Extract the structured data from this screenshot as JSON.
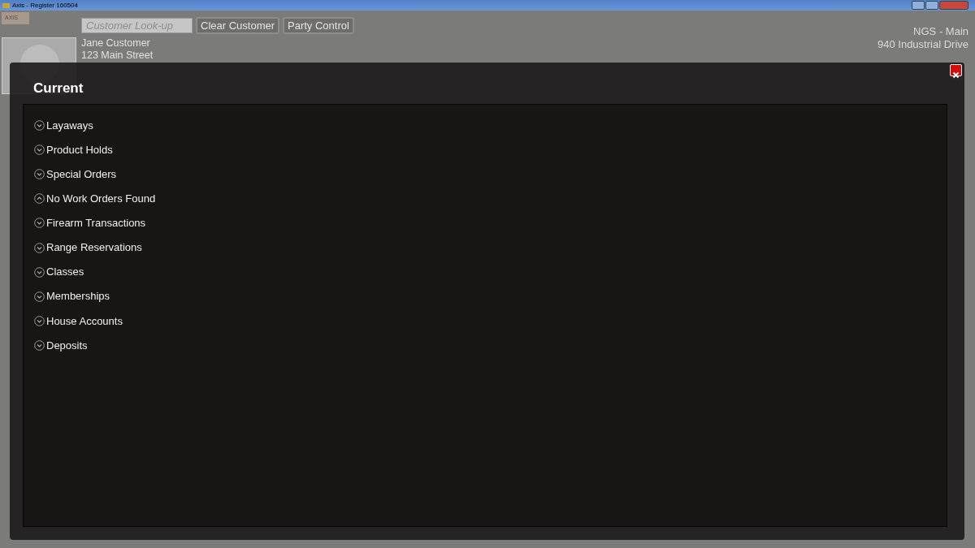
{
  "window": {
    "title": "Axis - Register  160504",
    "logo": "AXIS"
  },
  "customer_lookup": {
    "placeholder": "Customer Look-up"
  },
  "buttons": [
    "Clear Customer",
    "Party Control"
  ],
  "customer": {
    "lines": [
      "Jane Customer",
      "123 Main Street"
    ]
  },
  "store": {
    "name": "NGS - Main",
    "address": "940 Industrial Drive"
  },
  "dialog": {
    "title": "Current",
    "sections": [
      {
        "label": "Layaways",
        "expanded": false
      },
      {
        "label": "Product Holds",
        "expanded": false
      },
      {
        "label": "Special Orders",
        "expanded": false
      },
      {
        "label": "No Work Orders Found",
        "expanded": true
      },
      {
        "label": "Firearm Transactions",
        "expanded": false
      },
      {
        "label": "Range Reservations",
        "expanded": false
      },
      {
        "label": "Classes",
        "expanded": false
      },
      {
        "label": "Memberships",
        "expanded": false
      },
      {
        "label": "House Accounts",
        "expanded": false
      },
      {
        "label": "Deposits",
        "expanded": false
      }
    ]
  }
}
